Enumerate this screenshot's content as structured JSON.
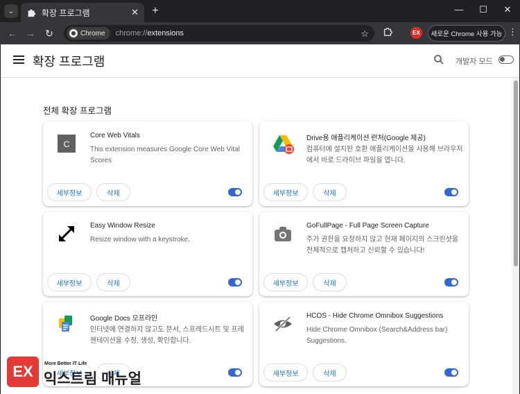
{
  "browser": {
    "tab_title": "확장 프로그램",
    "tab_close": "✕",
    "new_tab": "+",
    "window_controls": [
      "—",
      "☐",
      "✕"
    ],
    "address_chip": "Chrome",
    "url_scheme": "chrome://",
    "url_path": "extensions",
    "update_button": "새로운 Chrome 사용 가능",
    "profile_badge": "EX"
  },
  "header": {
    "title": "확장 프로그램",
    "developer_mode_label": "개발자 모드",
    "developer_mode": false
  },
  "section_title": "전체 확장 프로그램",
  "buttons": {
    "details": "세부정보",
    "remove": "삭제"
  },
  "extensions": [
    {
      "name": "Core Web Vitals",
      "description": "This extension measures Google Core Web Vital Scores",
      "enabled": true,
      "icon": "core-web-vitals-icon"
    },
    {
      "name": "Drive용 애플리케이션 런처(Google 제공)",
      "description": "컴퓨터에 설치된 호환 애플리케이션을 사용해 브라우저에서 바로 드라이브 파일을 엽니다.",
      "enabled": true,
      "icon": "google-drive-icon"
    },
    {
      "name": "Easy Window Resize",
      "description": "Resize window with a keystroke.",
      "enabled": true,
      "icon": "resize-arrows-icon"
    },
    {
      "name": "GoFullPage - Full Page Screen Capture",
      "description": "주가 권한을 요청하지 않고 현재 페이지의 스크린샷을 전체적으로 캡처하고 신뢰할 수 있습니다!",
      "enabled": true,
      "icon": "camera-icon"
    },
    {
      "name": "Google Docs 오프라인",
      "description": "인터넷에 연결하지 않고도 문서, 스프레드시트 및 프레젠테이션을 수정, 생성, 확인합니다.",
      "enabled": true,
      "icon": "google-docs-icon"
    },
    {
      "name": "HCOS - Hide Chrome Omnibox Suggestions",
      "description": "Hide Chrome Omnibox (Search&Address bar) Suggestions.",
      "enabled": true,
      "icon": "eye-off-icon"
    }
  ],
  "watermark": {
    "logo": "EX",
    "tagline": "More Better IT Life",
    "name": "익스트림 매뉴얼"
  },
  "colors": {
    "accent": "#1a73e8",
    "toggle_on": "#3367d6",
    "brand_red": "#e53935"
  }
}
